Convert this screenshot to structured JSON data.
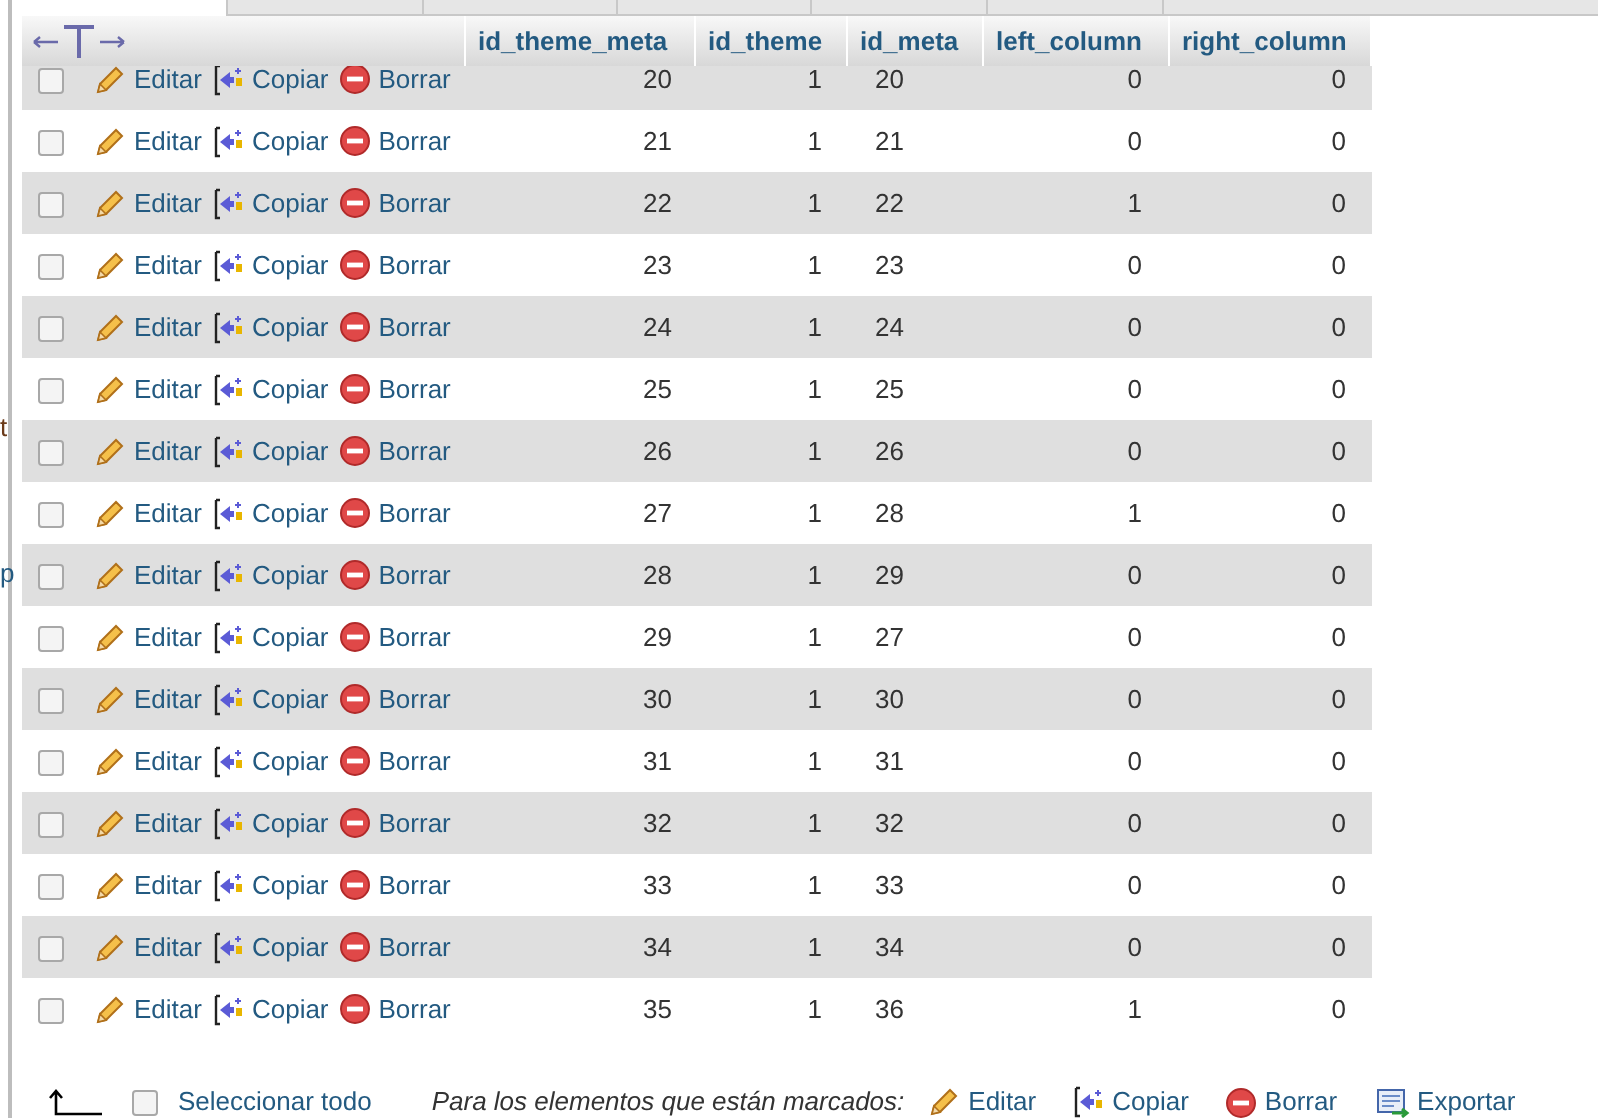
{
  "edge_fragments": [
    {
      "text": "t",
      "kind": "plain"
    },
    {
      "text": "p",
      "kind": "link"
    }
  ],
  "columns": [
    "id_theme_meta",
    "id_theme",
    "id_meta",
    "left_column",
    "right_column"
  ],
  "rows": [
    {
      "checked": false,
      "actions": [
        "Editar",
        "Copiar",
        "Borrar"
      ],
      "cells": [
        "20",
        "1",
        "20",
        "0",
        "0"
      ]
    },
    {
      "checked": false,
      "actions": [
        "Editar",
        "Copiar",
        "Borrar"
      ],
      "cells": [
        "21",
        "1",
        "21",
        "0",
        "0"
      ]
    },
    {
      "checked": false,
      "actions": [
        "Editar",
        "Copiar",
        "Borrar"
      ],
      "cells": [
        "22",
        "1",
        "22",
        "1",
        "0"
      ]
    },
    {
      "checked": false,
      "actions": [
        "Editar",
        "Copiar",
        "Borrar"
      ],
      "cells": [
        "23",
        "1",
        "23",
        "0",
        "0"
      ]
    },
    {
      "checked": false,
      "actions": [
        "Editar",
        "Copiar",
        "Borrar"
      ],
      "cells": [
        "24",
        "1",
        "24",
        "0",
        "0"
      ]
    },
    {
      "checked": false,
      "actions": [
        "Editar",
        "Copiar",
        "Borrar"
      ],
      "cells": [
        "25",
        "1",
        "25",
        "0",
        "0"
      ]
    },
    {
      "checked": false,
      "actions": [
        "Editar",
        "Copiar",
        "Borrar"
      ],
      "cells": [
        "26",
        "1",
        "26",
        "0",
        "0"
      ]
    },
    {
      "checked": false,
      "actions": [
        "Editar",
        "Copiar",
        "Borrar"
      ],
      "cells": [
        "27",
        "1",
        "28",
        "1",
        "0"
      ]
    },
    {
      "checked": false,
      "actions": [
        "Editar",
        "Copiar",
        "Borrar"
      ],
      "cells": [
        "28",
        "1",
        "29",
        "0",
        "0"
      ]
    },
    {
      "checked": false,
      "actions": [
        "Editar",
        "Copiar",
        "Borrar"
      ],
      "cells": [
        "29",
        "1",
        "27",
        "0",
        "0"
      ]
    },
    {
      "checked": false,
      "actions": [
        "Editar",
        "Copiar",
        "Borrar"
      ],
      "cells": [
        "30",
        "1",
        "30",
        "0",
        "0"
      ]
    },
    {
      "checked": false,
      "actions": [
        "Editar",
        "Copiar",
        "Borrar"
      ],
      "cells": [
        "31",
        "1",
        "31",
        "0",
        "0"
      ]
    },
    {
      "checked": false,
      "actions": [
        "Editar",
        "Copiar",
        "Borrar"
      ],
      "cells": [
        "32",
        "1",
        "32",
        "0",
        "0"
      ]
    },
    {
      "checked": false,
      "actions": [
        "Editar",
        "Copiar",
        "Borrar"
      ],
      "cells": [
        "33",
        "1",
        "33",
        "0",
        "0"
      ]
    },
    {
      "checked": false,
      "actions": [
        "Editar",
        "Copiar",
        "Borrar"
      ],
      "cells": [
        "34",
        "1",
        "34",
        "0",
        "0"
      ]
    },
    {
      "checked": false,
      "actions": [
        "Editar",
        "Copiar",
        "Borrar"
      ],
      "cells": [
        "35",
        "1",
        "36",
        "1",
        "0"
      ]
    }
  ],
  "footer": {
    "select_all": {
      "label": "Seleccionar todo",
      "checked": false
    },
    "marked_label": "Para los elementos que están marcados:",
    "actions": [
      {
        "kind": "edit",
        "label": "Editar"
      },
      {
        "kind": "copy",
        "label": "Copiar"
      },
      {
        "kind": "delete",
        "label": "Borrar"
      },
      {
        "kind": "export",
        "label": "Exportar"
      }
    ]
  }
}
